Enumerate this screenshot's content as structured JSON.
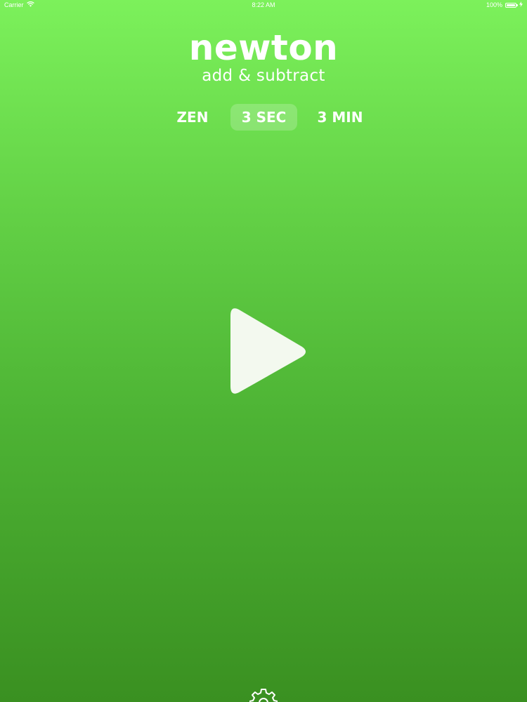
{
  "status_bar": {
    "carrier": "Carrier",
    "time": "8:22 AM",
    "battery_text": "100%",
    "battery_level": 1.0
  },
  "app": {
    "title": "newton",
    "subtitle": "add & subtract"
  },
  "modes": {
    "items": [
      {
        "label": "ZEN",
        "selected": false
      },
      {
        "label": "3 SEC",
        "selected": true
      },
      {
        "label": "3 MIN",
        "selected": false
      }
    ]
  },
  "icons": {
    "wifi": "wifi-icon",
    "battery": "battery-icon",
    "charging": "charging-bolt-icon",
    "play": "play-icon",
    "settings": "gear-icon"
  },
  "colors": {
    "gradient_top": "#7cf15b",
    "gradient_bottom": "#3a9021",
    "foreground": "#ffffff",
    "selected_mode_bg": "rgba(255,255,255,0.2)"
  }
}
